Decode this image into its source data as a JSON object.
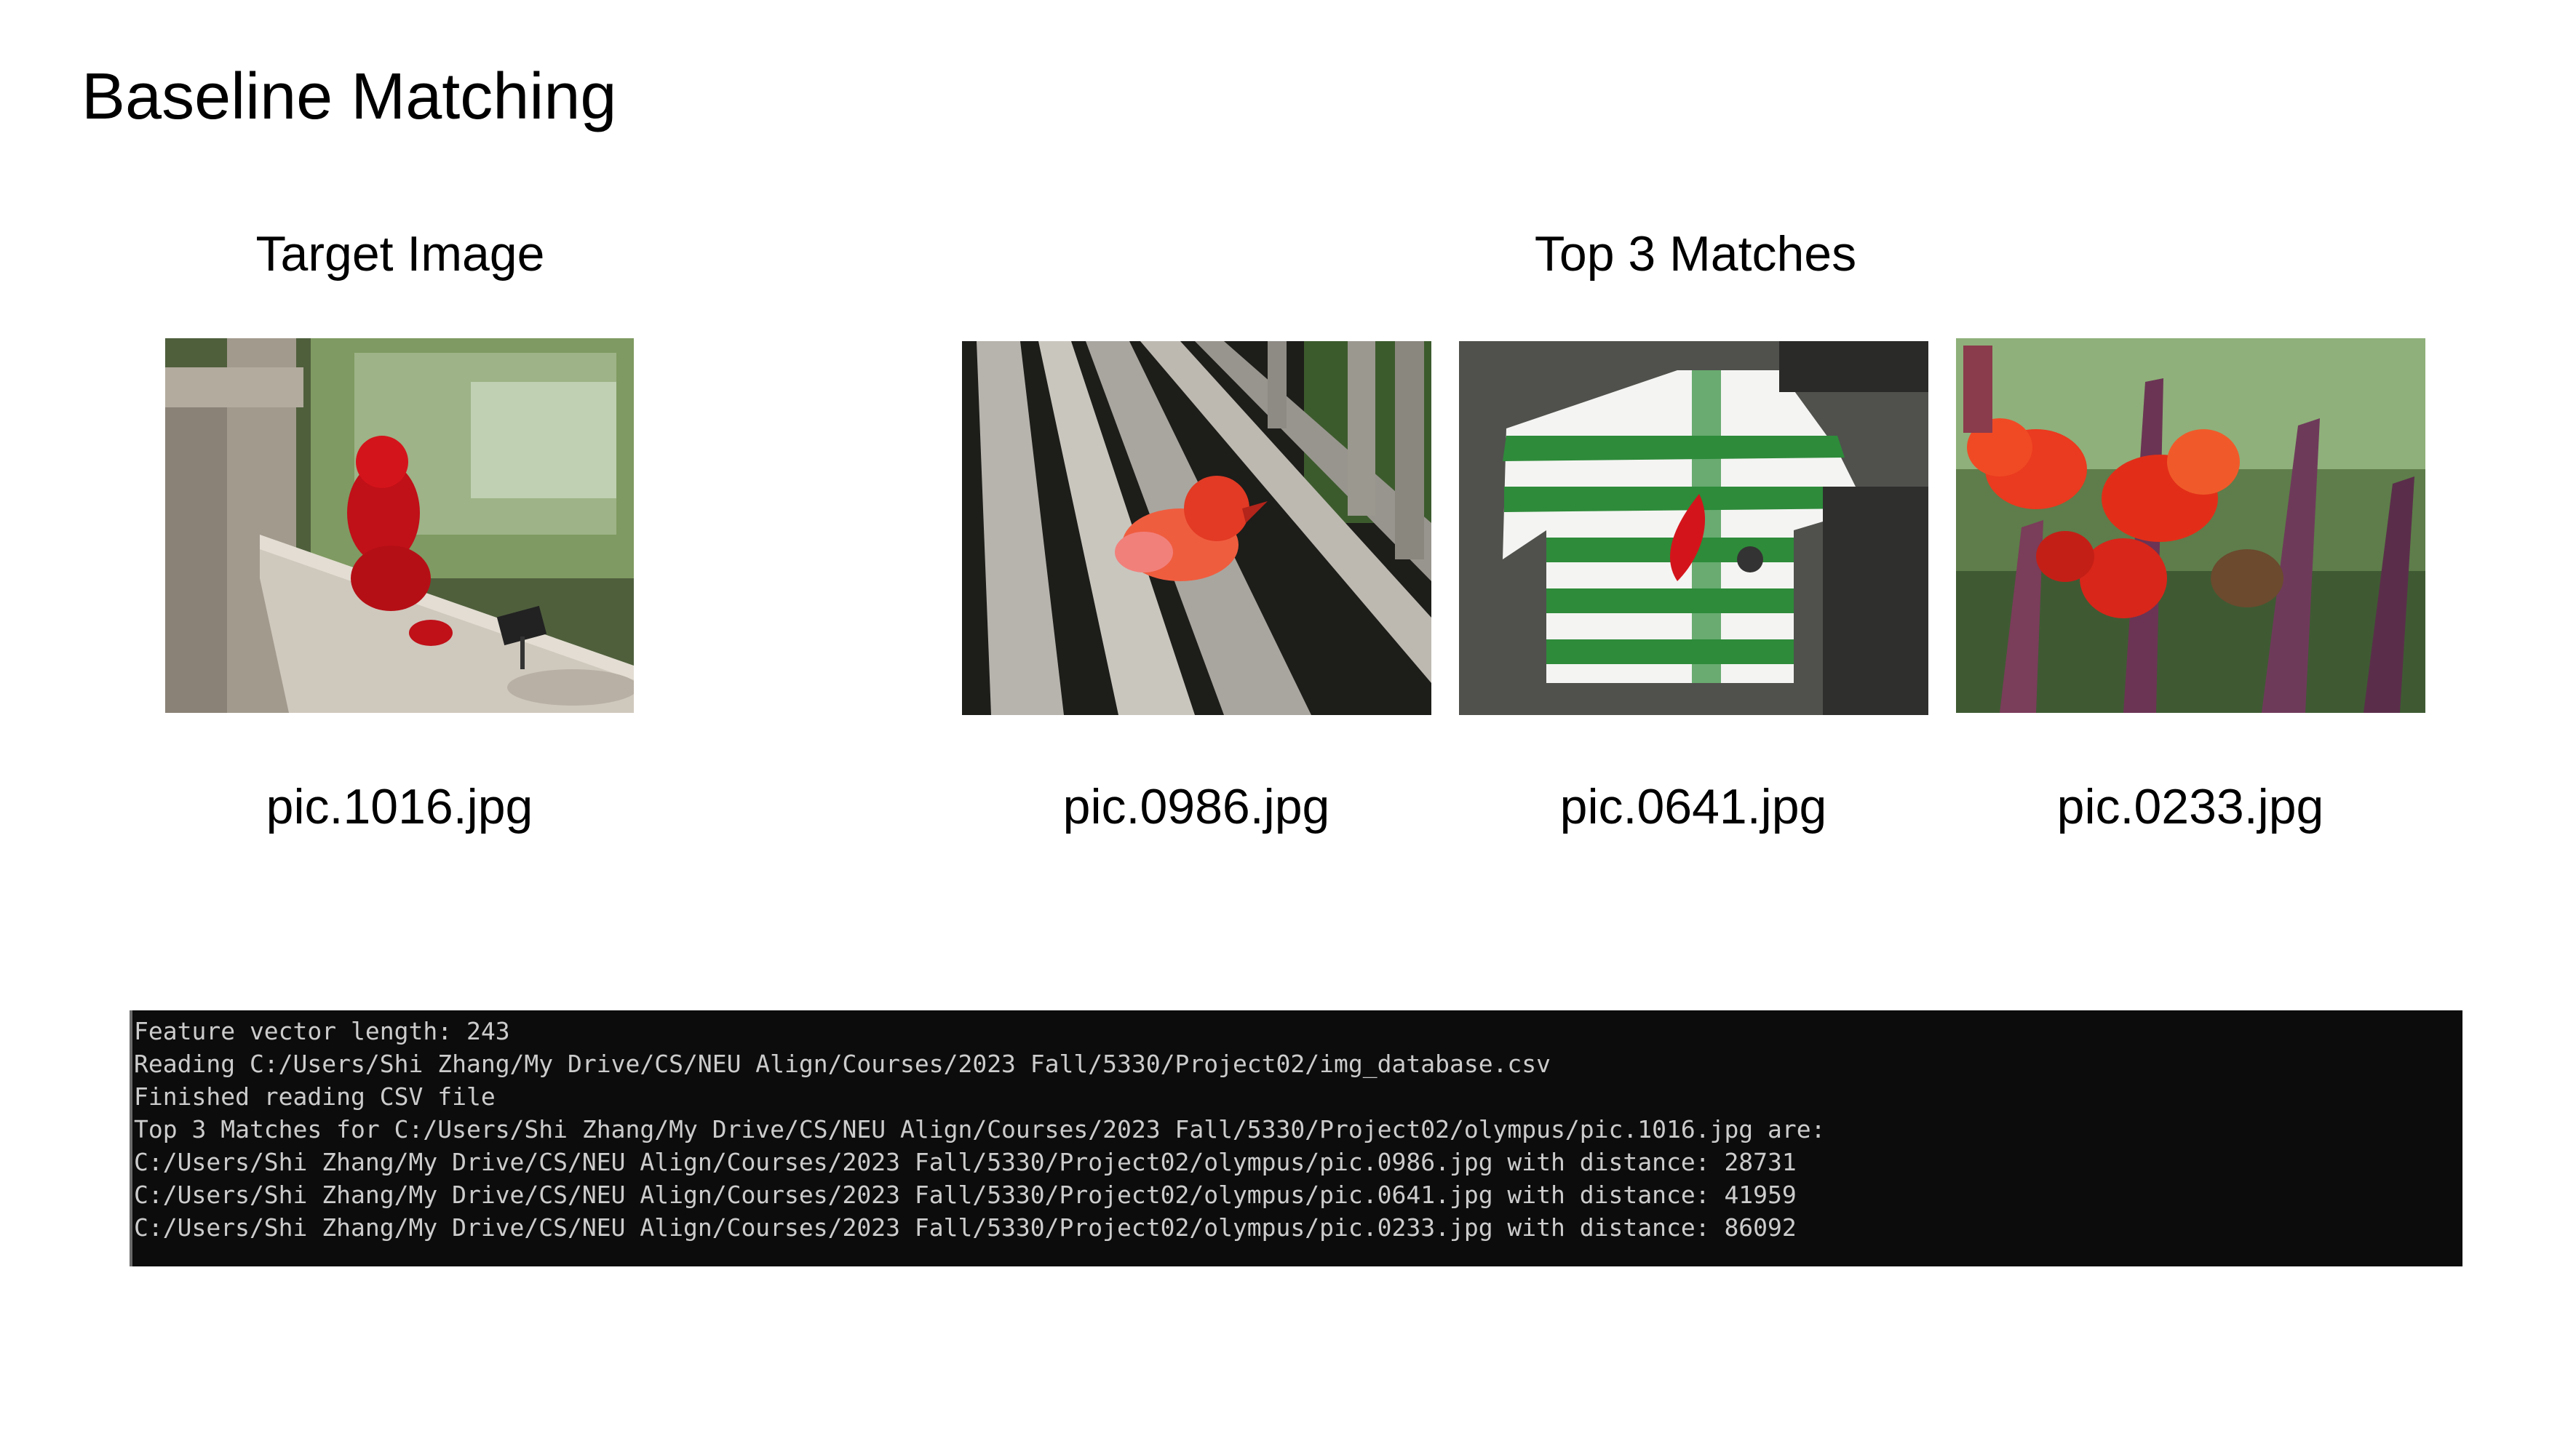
{
  "slide": {
    "title": "Baseline Matching"
  },
  "target": {
    "heading": "Target Image",
    "filename": "pic.1016.jpg",
    "photo_icon": "red-gummy-bear-on-bench-photo"
  },
  "matches": {
    "heading": "Top 3 Matches",
    "items": [
      {
        "filename": "pic.0986.jpg",
        "photo_icon": "red-duck-toy-on-bench-photo"
      },
      {
        "filename": "pic.0641.jpg",
        "photo_icon": "green-striped-jersey-photo"
      },
      {
        "filename": "pic.0233.jpg",
        "photo_icon": "red-canna-flowers-photo"
      }
    ]
  },
  "terminal": {
    "lines": [
      "Feature vector length: 243",
      "Reading C:/Users/Shi Zhang/My Drive/CS/NEU Align/Courses/2023 Fall/5330/Project02/img_database.csv",
      "Finished reading CSV file",
      "Top 3 Matches for C:/Users/Shi Zhang/My Drive/CS/NEU Align/Courses/2023 Fall/5330/Project02/olympus/pic.1016.jpg are:",
      "C:/Users/Shi Zhang/My Drive/CS/NEU Align/Courses/2023 Fall/5330/Project02/olympus/pic.0986.jpg with distance: 28731",
      "C:/Users/Shi Zhang/My Drive/CS/NEU Align/Courses/2023 Fall/5330/Project02/olympus/pic.0641.jpg with distance: 41959",
      "C:/Users/Shi Zhang/My Drive/CS/NEU Align/Courses/2023 Fall/5330/Project02/olympus/pic.0233.jpg with distance: 86092"
    ]
  },
  "colors": {
    "terminal_bg": "#0c0c0c",
    "terminal_text": "#cccccc",
    "accent_red": "#d4141b",
    "jersey_green": "#2e8b3a"
  }
}
